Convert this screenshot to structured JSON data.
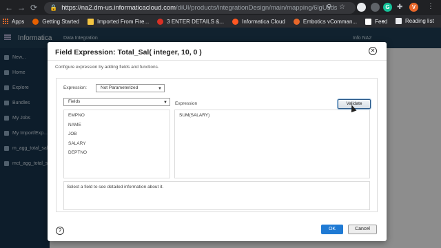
{
  "browser": {
    "url_host": "https://na2.dm-us.informaticacloud.com",
    "url_path": "/diUI/products/integrationDesign/main/mapping/6lgUsds...",
    "profile_initial": "V",
    "ext_initial": "G",
    "bookmarks": [
      {
        "label": "Apps",
        "icon": "apps-grid-icon",
        "color": "#e8672a"
      },
      {
        "label": "Getting Started",
        "icon": "firefox-icon",
        "color": "#e66000"
      },
      {
        "label": "Imported From Fire...",
        "icon": "folder-icon",
        "color": "#f4c542"
      },
      {
        "label": "3 ENTER DETAILS &...",
        "icon": "site-icon",
        "color": "#d93025"
      },
      {
        "label": "Informatica Cloud",
        "icon": "informatica-icon",
        "color": "#ff5722"
      },
      {
        "label": "Embotics vComman...",
        "icon": "embotics-icon",
        "color": "#e8672a"
      },
      {
        "label": "Feed",
        "icon": "feed-icon",
        "color": "#ffffff"
      }
    ],
    "reading_list": "Reading list",
    "more": "»"
  },
  "app": {
    "brand": "Informatica",
    "service": "Data Integration",
    "user": "Info NA2",
    "sidebar": [
      "New...",
      "Home",
      "Explore",
      "Bundles",
      "My Jobs",
      "My Import/Exp...",
      "m_agg_total_sal...",
      "mct_agg_total_s..."
    ]
  },
  "dialog": {
    "title": "Field Expression: Total_Sal( integer, 10, 0 )",
    "description": "Configure expression by adding fields and functions.",
    "expression_label": "Expression:",
    "expression_select": "Not Parameterized",
    "fields_select": "Fields",
    "fields": [
      "EMPNO",
      "NAME",
      "JOB",
      "SALARY",
      "DEPTNO"
    ],
    "expression_area_label": "Expression",
    "expression_text": "SUM(SALARY)",
    "validate_label": "Validate",
    "info_text": "Select a field to see detailed information about it.",
    "ok_label": "OK",
    "cancel_label": "Cancel",
    "help_glyph": "?",
    "close_glyph": "✕"
  },
  "colors": {
    "browser_bg": "#202124",
    "app_header": "#1e3b52",
    "primary_button": "#1f7ad4"
  }
}
